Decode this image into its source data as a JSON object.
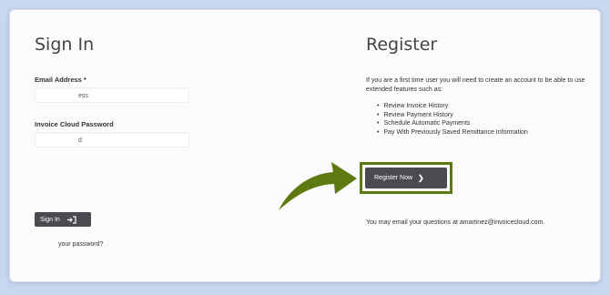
{
  "signin": {
    "title": "Sign In",
    "email_label": "Email Address *",
    "email_value": "ess",
    "password_label": "Invoice Cloud Password",
    "password_value": "d",
    "button_label": "Sign In",
    "forgot_link": "your password?"
  },
  "register": {
    "title": "Register",
    "intro": "If you are a first time user you will need to create an account to be able to use extended features such as:",
    "features": [
      "Review Invoice History",
      "Review Payment History",
      "Schedule Automatic Payments",
      "Pay With Previously Saved Remittance Information"
    ],
    "button_label": "Register Now",
    "contact": "You may email your questions at amartinez@invoicecloud.com."
  },
  "colors": {
    "page_bg": "#c8d6ee",
    "card_bg": "#fbfbfc",
    "button_bg": "#4a4b4f",
    "highlight": "#5d7a12"
  }
}
